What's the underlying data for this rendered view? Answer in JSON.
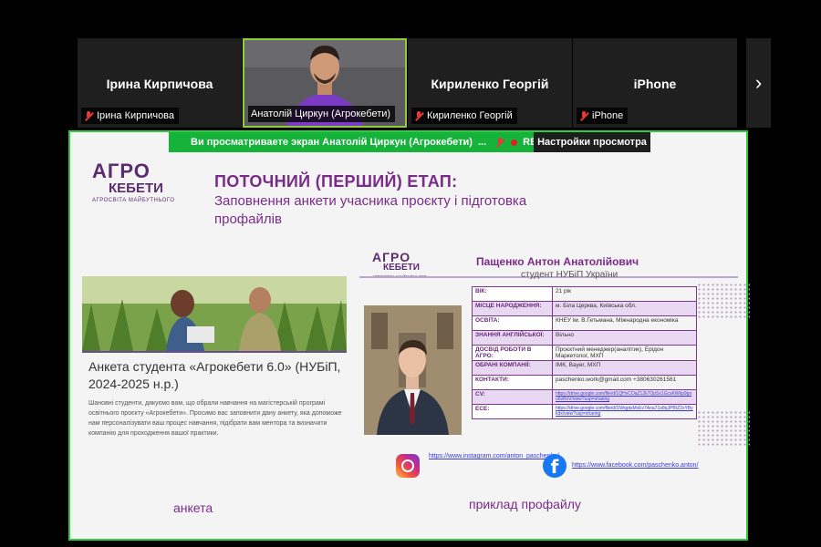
{
  "participants": [
    {
      "display_name": "Ірина Кирпичова",
      "tag_name": "Ірина Кирпичова"
    },
    {
      "tag_name": "Анатолій Циркун (Агрокебети)"
    },
    {
      "display_name": "Кириленко Георгій",
      "tag_name": "Кириленко Георгій"
    },
    {
      "display_name": "iPhone",
      "tag_name": "iPhone"
    }
  ],
  "next_arrow": "›",
  "share_bar": {
    "text": "Ви просматриваете экран  Анатолій Циркун (Агрокебети)",
    "ellipsis": "...",
    "rec": "REC",
    "view_settings": "Настройки просмотра"
  },
  "slide": {
    "logo": {
      "line1": "АГРО",
      "line2": "КЕБЕТИ",
      "tagline": "АГРОСВІТА МАЙБУТНЬОГО"
    },
    "title_main": "ПОТОЧНИЙ (ПЕРШИЙ) ЕТАП:",
    "title_sub": "Заповнення анкети учасника проєкту і підготовка профайлів",
    "form": {
      "title": "Анкета студента «Агрокебети 6.0» (НУБіП, 2024-2025 н.р.)",
      "text": "Шановні студенти, дякуємо вам, що обрали навчання на магістерській програмі освітнього проєкту «Агрокебети». Просимо вас заповнити дану анкету, яка допоможе нам персоналізувати ваш процес навчання, підібрати вам ментора та визначити компанію для проходження вашої практики."
    },
    "profile": {
      "name": "Пащенко Антон Анатолійович",
      "status": "студент НУБіП України",
      "rows": [
        {
          "k": "ВІК:",
          "v": "21 рік"
        },
        {
          "k": "МІСЦЕ НАРОДЖЕННЯ:",
          "v": "м. Біла Церква, Київська обл."
        },
        {
          "k": "ОСВІТА:",
          "v": "КНЕУ ім. В.Гетьмана, Міжнародна економіка"
        },
        {
          "k": "ЗНАННЯ АНГЛІЙСЬКОЇ:",
          "v": "Вільно"
        },
        {
          "k": "ДОСВІД РОБОТИ В АГРО:",
          "v": "Проєктний менеджер(аналітик), Ерідон Маркетолог, МХП"
        },
        {
          "k": "ОБРАНІ КОМПАНІЇ:",
          "v": "ІМК, Bayer, МХП"
        },
        {
          "k": "КОНТАКТИ:",
          "v": "paschenko.work@gmail.com +380630261561"
        },
        {
          "k": "CV:",
          "v": "https://drive.google.com/file/d/1QHvCOaZ12k7OpSx1GcsKWkp9gou6vRsV/view?usp=sharing"
        },
        {
          "k": "ЕСЕ:",
          "v": "https://drive.google.com/file/d/1lWqptsMvEv7Ana71o8qJPBIZ2sYBykdx/view?usp=sharing"
        }
      ],
      "instagram": "https://www.instagram.com/anton_paschenko/",
      "facebook": "https://www.facebook.com/paschenko.anton/"
    },
    "caption_left": "анкета",
    "caption_right": "приклад профайлу"
  },
  "colors": {
    "accent": "#7a2b8a",
    "share_border": "#2ecc40",
    "active_speaker": "#8fce3a",
    "rec": "#e02020"
  }
}
